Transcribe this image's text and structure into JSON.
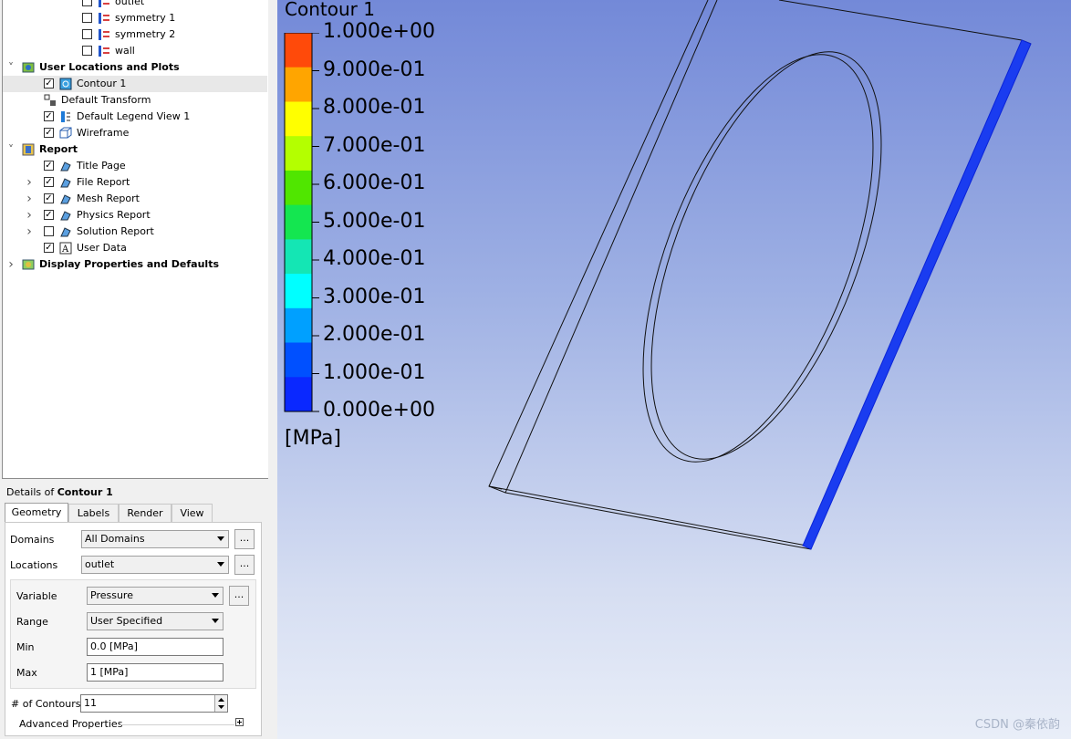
{
  "tree": {
    "items": [
      {
        "label": "outlet",
        "level": 3,
        "checked": false,
        "icon": "boundary-icon"
      },
      {
        "label": "symmetry 1",
        "level": 3,
        "checked": false,
        "icon": "boundary-icon"
      },
      {
        "label": "symmetry 2",
        "level": 3,
        "checked": false,
        "icon": "boundary-icon"
      },
      {
        "label": "wall",
        "level": 3,
        "checked": false,
        "icon": "boundary-icon"
      },
      {
        "label": "User Locations and Plots",
        "level": 1,
        "bold": true,
        "expanded": true,
        "icon": "user-locations-icon"
      },
      {
        "label": "Contour 1",
        "level": 2,
        "checked": true,
        "selected": true,
        "icon": "contour-icon"
      },
      {
        "label": "Default Transform",
        "level": 2,
        "icon": "transform-icon"
      },
      {
        "label": "Default Legend View 1",
        "level": 2,
        "checked": true,
        "icon": "legend-icon"
      },
      {
        "label": "Wireframe",
        "level": 2,
        "checked": true,
        "icon": "wireframe-icon"
      },
      {
        "label": "Report",
        "level": 1,
        "bold": true,
        "expanded": true,
        "icon": "report-icon"
      },
      {
        "label": "Title Page",
        "level": 2,
        "checked": true,
        "icon": "report-item-icon"
      },
      {
        "label": "File Report",
        "level": 2,
        "checked": true,
        "collapsed": true,
        "icon": "report-item-icon"
      },
      {
        "label": "Mesh Report",
        "level": 2,
        "checked": true,
        "collapsed": true,
        "icon": "report-item-icon"
      },
      {
        "label": "Physics Report",
        "level": 2,
        "checked": true,
        "collapsed": true,
        "icon": "report-item-icon"
      },
      {
        "label": "Solution Report",
        "level": 2,
        "checked": false,
        "collapsed": true,
        "icon": "report-item-icon"
      },
      {
        "label": "User Data",
        "level": 2,
        "checked": true,
        "icon": "user-data-icon"
      },
      {
        "label": "Display Properties and Defaults",
        "level": 1,
        "bold": true,
        "collapsed": true,
        "icon": "display-properties-icon"
      }
    ]
  },
  "details": {
    "prefix": "Details of ",
    "object": "Contour 1",
    "tabs": [
      "Geometry",
      "Labels",
      "Render",
      "View"
    ],
    "active_tab": "Geometry",
    "domains_label": "Domains",
    "domains_value": "All Domains",
    "locations_label": "Locations",
    "locations_value": "outlet",
    "variable_label": "Variable",
    "variable_value": "Pressure",
    "range_label": "Range",
    "range_value": "User Specified",
    "min_label": "Min",
    "min_value": "0.0 [MPa]",
    "max_label": "Max",
    "max_value": "1 [MPa]",
    "contours_label": "# of Contours",
    "contours_value": "11",
    "advanced_label": "Advanced Properties",
    "ellipsis": "..."
  },
  "viewer": {
    "legend_title": "Contour 1",
    "legend_unit": "[MPa]",
    "legend_ticks": [
      "1.000e+00",
      "9.000e-01",
      "8.000e-01",
      "7.000e-01",
      "6.000e-01",
      "5.000e-01",
      "4.000e-01",
      "3.000e-01",
      "2.000e-01",
      "1.000e-01",
      "0.000e+00"
    ],
    "legend_colors": [
      "#ff4a0a",
      "#ffa500",
      "#ffff00",
      "#b4ff00",
      "#50e600",
      "#14e650",
      "#14e6b4",
      "#00ffff",
      "#00a0ff",
      "#0050ff",
      "#0a28ff"
    ],
    "watermark": "CSDN @秦依韵"
  }
}
